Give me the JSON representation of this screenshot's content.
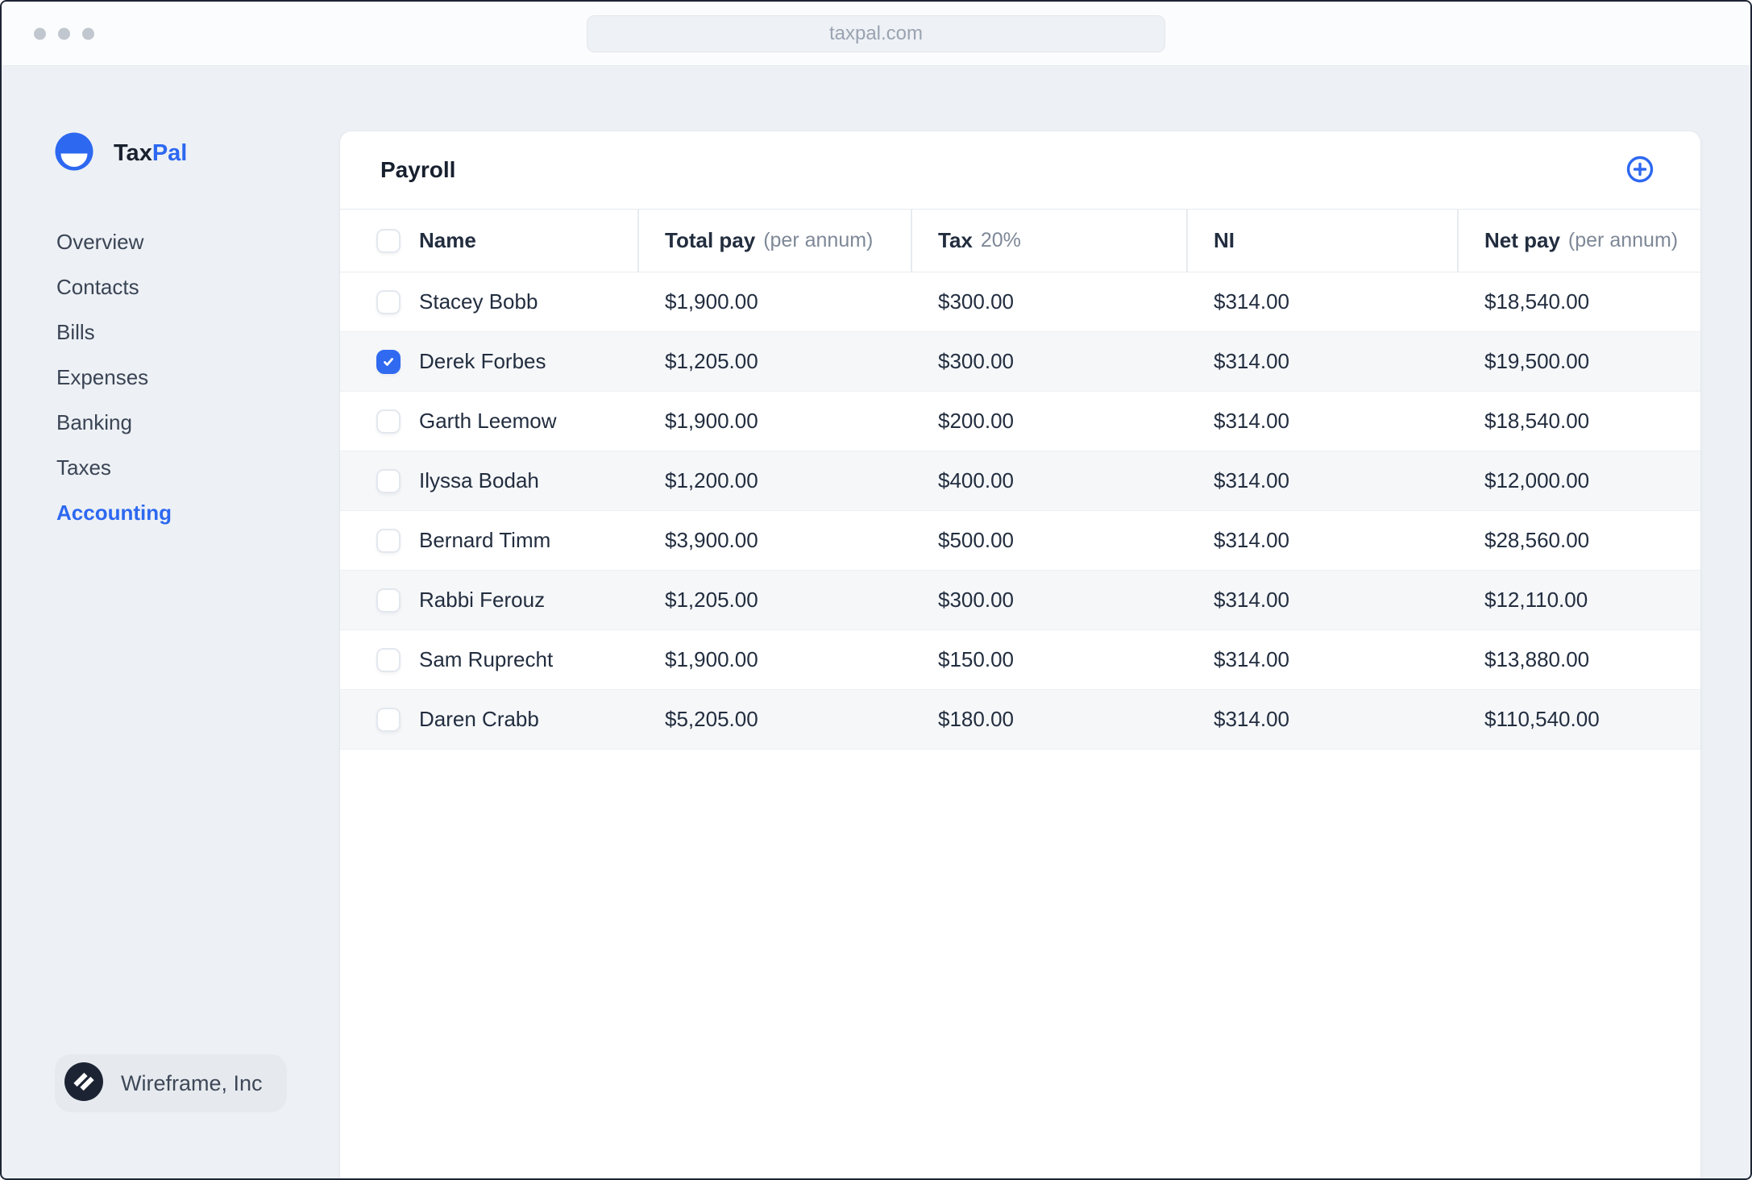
{
  "browser": {
    "url": "taxpal.com"
  },
  "sidebar": {
    "brand": {
      "word_dark": "Tax",
      "word_accent": "Pal"
    },
    "items": [
      {
        "label": "Overview",
        "active": false
      },
      {
        "label": "Contacts",
        "active": false
      },
      {
        "label": "Bills",
        "active": false
      },
      {
        "label": "Expenses",
        "active": false
      },
      {
        "label": "Banking",
        "active": false
      },
      {
        "label": "Taxes",
        "active": false
      },
      {
        "label": "Accounting",
        "active": true
      }
    ],
    "footer": {
      "company": "Wireframe, Inc"
    }
  },
  "payroll": {
    "title": "Payroll",
    "add_button": "add-employee",
    "columns": [
      {
        "label": "Name",
        "sub": ""
      },
      {
        "label": "Total pay",
        "sub": "(per annum)"
      },
      {
        "label": "Tax",
        "sub": "20%"
      },
      {
        "label": "NI",
        "sub": ""
      },
      {
        "label": "Net pay",
        "sub": "(per annum)"
      }
    ],
    "rows": [
      {
        "name": "Stacey Bobb",
        "checked": false,
        "total_pay": "$1,900.00",
        "tax": "$300.00",
        "ni": "$314.00",
        "net_pay": "$18,540.00"
      },
      {
        "name": "Derek Forbes",
        "checked": true,
        "total_pay": "$1,205.00",
        "tax": "$300.00",
        "ni": "$314.00",
        "net_pay": "$19,500.00"
      },
      {
        "name": "Garth Leemow",
        "checked": false,
        "total_pay": "$1,900.00",
        "tax": "$200.00",
        "ni": "$314.00",
        "net_pay": "$18,540.00"
      },
      {
        "name": "Ilyssa Bodah",
        "checked": false,
        "total_pay": "$1,200.00",
        "tax": "$400.00",
        "ni": "$314.00",
        "net_pay": "$12,000.00"
      },
      {
        "name": "Bernard Timm",
        "checked": false,
        "total_pay": "$3,900.00",
        "tax": "$500.00",
        "ni": "$314.00",
        "net_pay": "$28,560.00"
      },
      {
        "name": "Rabbi Ferouz",
        "checked": false,
        "total_pay": "$1,205.00",
        "tax": "$300.00",
        "ni": "$314.00",
        "net_pay": "$12,110.00"
      },
      {
        "name": "Sam Ruprecht",
        "checked": false,
        "total_pay": "$1,900.00",
        "tax": "$150.00",
        "ni": "$314.00",
        "net_pay": "$13,880.00"
      },
      {
        "name": "Daren Crabb",
        "checked": false,
        "total_pay": "$5,205.00",
        "tax": "$180.00",
        "ni": "$314.00",
        "net_pay": "$110,540.00"
      }
    ]
  },
  "colors": {
    "accent": "#2d68f0",
    "checkbox_checked": "#2f6af0",
    "row_stripe": "#f5f7f9",
    "page_background": "#edf1f5",
    "text_dark": "#222d3f"
  }
}
